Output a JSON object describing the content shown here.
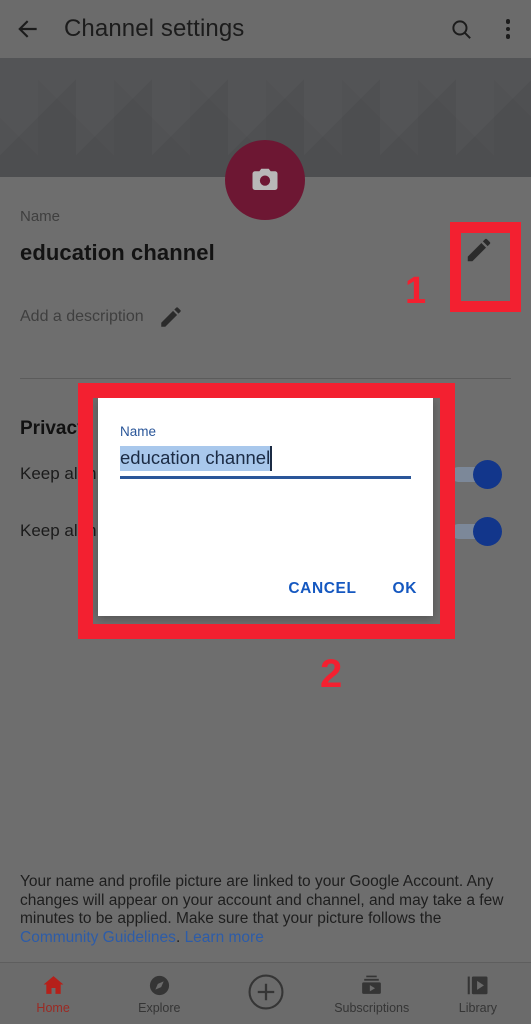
{
  "appbar": {
    "back_icon": "arrow-left-icon",
    "title": "Channel settings",
    "search_icon": "search-icon",
    "overflow_icon": "more-vertical-icon"
  },
  "banner": {
    "avatar_icon": "camera-icon",
    "avatar_color": "#6d1733"
  },
  "profile": {
    "name_label": "Name",
    "name_value": "education channel",
    "name_edit_icon": "pencil-icon",
    "description_label": "Add a description",
    "description_edit_icon": "pencil-icon"
  },
  "privacy": {
    "title": "Privacy",
    "rows": [
      {
        "label": "Keep al   m",
        "toggle_on": true
      },
      {
        "label": "Keep al   m",
        "toggle_on": true
      }
    ]
  },
  "dialog": {
    "field_label": "Name",
    "input_value": "education channel",
    "cancel_label": "CANCEL",
    "ok_label": "OK",
    "accent_color": "#1558c0",
    "selection_color": "#a9c8ec"
  },
  "footnote": {
    "part1": "Your name and profile picture are linked to your Google Account. Any changes will appear on your account and channel, and may take a few minutes to be applied. Make sure that your picture follows the ",
    "link1": "Community Guidelines",
    "part2": ". ",
    "link2": "Learn more"
  },
  "bottom_nav": {
    "items": [
      {
        "label": "Home",
        "icon": "home-icon",
        "active": true
      },
      {
        "label": "Explore",
        "icon": "compass-icon",
        "active": false
      },
      {
        "label": "",
        "icon": "plus-circle-icon",
        "active": false
      },
      {
        "label": "Subscriptions",
        "icon": "subscriptions-icon",
        "active": false
      },
      {
        "label": "Library",
        "icon": "library-icon",
        "active": false
      }
    ]
  },
  "annotations": {
    "marker_1": "1",
    "marker_2": "2",
    "color": "#f32030"
  }
}
